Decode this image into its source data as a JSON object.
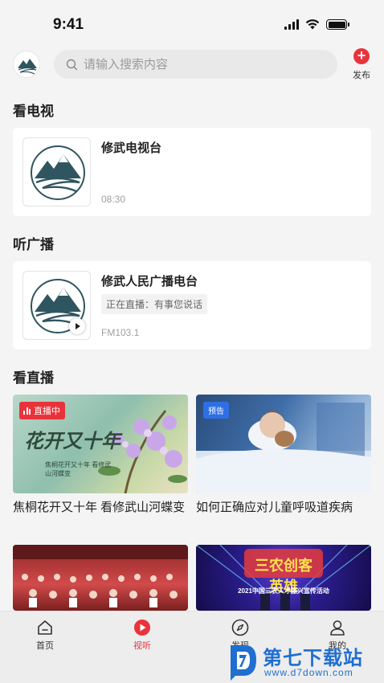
{
  "status_bar": {
    "time": "9:41"
  },
  "header": {
    "search_placeholder": "请输入搜索内容",
    "publish_label": "发布"
  },
  "sections": {
    "tv": "看电视",
    "radio": "听广播",
    "live": "看直播"
  },
  "tv_card": {
    "title": "修武电视台",
    "sub": "08:30"
  },
  "radio_card": {
    "title": "修武人民广播电台",
    "live_text": "正在直播：有事您说话",
    "sub": "FM103.1"
  },
  "videos": [
    {
      "badge": "直播中",
      "title": "焦桐花开又十年 看修武山河蝶变",
      "thumb_text": "花开又十年",
      "thumb_caption": "焦桐花开又十年 看修武山河蝶变"
    },
    {
      "badge": "预告",
      "title": "如何正确应对儿童呼吸道疾病"
    },
    {
      "title": ""
    },
    {
      "title": "",
      "thumb_text": "三农创客英雄",
      "thumb_caption": "2021中国三农人才振兴宣传活动"
    }
  ],
  "tabbar": [
    {
      "label": "首页",
      "icon": "home-icon"
    },
    {
      "label": "视听",
      "icon": "play-circle-icon"
    },
    {
      "label": "发现",
      "icon": "compass-icon"
    },
    {
      "label": "我的",
      "icon": "user-icon"
    }
  ],
  "watermark": {
    "name": "第七下载站",
    "url": "www.d7down.com"
  },
  "colors": {
    "accent": "#e8333b",
    "preview": "#2e6fe6",
    "watermark": "#1f6fd0"
  }
}
